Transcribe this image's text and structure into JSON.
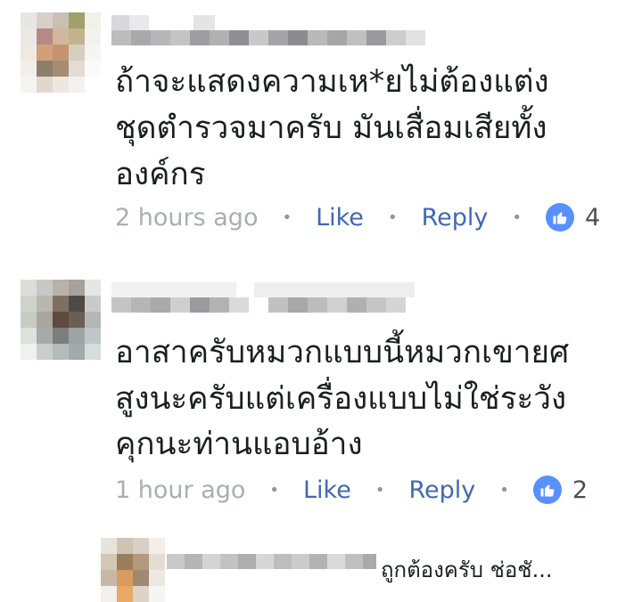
{
  "comments": [
    {
      "text_lines": [
        "ถ้าจะแสดงความเห*ยไม่ต้องแต่ง",
        "ชุดตำรวจมาครับ มันเสื่อมเสียทั้ง",
        "องค์กร"
      ],
      "time": "2 hours ago",
      "like_label": "Like",
      "reply_label": "Reply",
      "reaction_count": "4",
      "separator": "•"
    },
    {
      "text_lines": [
        "อาสาครับหมวกแบบนี้หมวกเขายศ",
        "สูงนะครับแต่เครื่องแบบไม่ใช่ระวัง",
        "คุกนะท่านแอบอ้าง"
      ],
      "time": "1 hour ago",
      "like_label": "Like",
      "reply_label": "Reply",
      "reaction_count": "2",
      "separator": "•"
    }
  ],
  "reply_preview": {
    "text": "ถูกต้องครับ ช่อชั..."
  },
  "colors": {
    "link": "#4267b2",
    "like_badge": "#5890ff",
    "meta_gray": "#90949c"
  },
  "icons": {
    "reaction": "thumbs-up-icon",
    "avatar": "pixelated-avatar"
  }
}
